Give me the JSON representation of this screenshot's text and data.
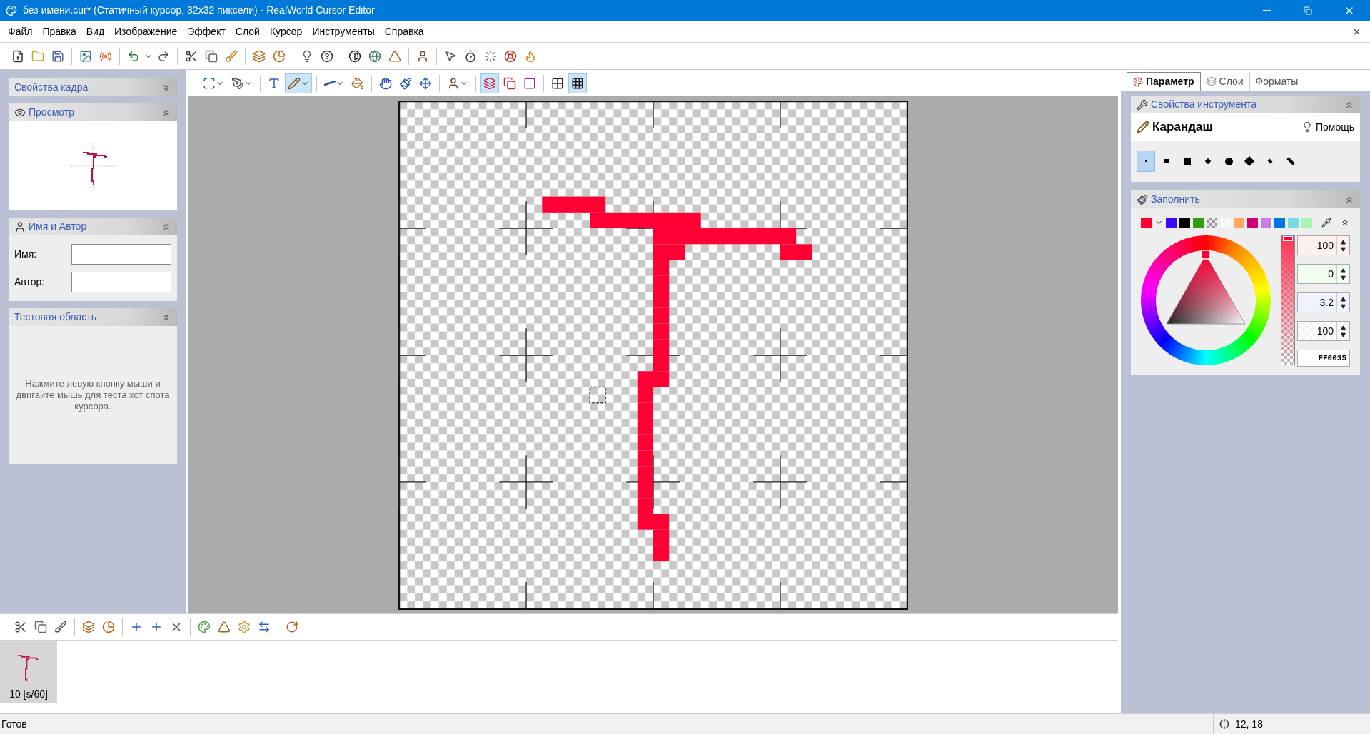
{
  "window": {
    "title": "без имени.cur* (Статичный курсор, 32x32 пиксели) - RealWorld Cursor Editor"
  },
  "menu": [
    "Файл",
    "Правка",
    "Вид",
    "Изображение",
    "Эффект",
    "Слой",
    "Курсор",
    "Инструменты",
    "Справка"
  ],
  "tools": [
    {
      "selected": false
    },
    {
      "selected": false
    },
    {
      "selected": false
    },
    {
      "selected": true
    },
    {
      "selected": false
    },
    {
      "selected": false
    },
    {
      "selected": false
    },
    {
      "selected": false
    },
    {
      "selected": false
    },
    {
      "selected": false
    },
    {
      "selected": true
    },
    {
      "selected": false
    },
    {
      "selected": false
    },
    {
      "selected": false
    },
    {
      "selected": true
    }
  ],
  "left_panels": {
    "frame_props": {
      "title": "Свойства кадра",
      "expanded": false
    },
    "preview": {
      "title": "Просмотр",
      "expanded": true
    },
    "name_author": {
      "title": "Имя и Автор",
      "expanded": true,
      "fields": [
        {
          "label": "Имя:"
        },
        {
          "label": "Автор:"
        }
      ]
    },
    "test_area": {
      "title": "Тестовая область",
      "expanded": true,
      "hint": "Нажмите левую кнопку мыши и двигайте мышь для теста хот спота курсора."
    }
  },
  "right_tabs": [
    {
      "label": "Параметр",
      "selected": true
    },
    {
      "label": "Слои",
      "selected": false
    },
    {
      "label": "Форматы",
      "selected": false
    }
  ],
  "tool_properties": {
    "title": "Свойства инструмента",
    "expanded": true,
    "tool_name": "Карандаш",
    "help": "Помощь",
    "brushes": [
      {
        "selected": true
      },
      {
        "selected": false
      },
      {
        "selected": false
      },
      {
        "selected": false
      },
      {
        "selected": false
      },
      {
        "selected": false
      },
      {
        "selected": false
      },
      {
        "selected": false
      }
    ]
  },
  "fill": {
    "title": "Заполнить",
    "expanded": true,
    "palette": [
      {
        "kind": "solid",
        "color": "#3b0aff"
      },
      {
        "kind": "solid",
        "color": "#000000"
      },
      {
        "kind": "solid",
        "color": "#2f9e0f"
      },
      {
        "kind": "transparent"
      },
      {
        "kind": "solid",
        "color": "#f8f8f8"
      },
      {
        "kind": "solid",
        "color": "#ffa860"
      },
      {
        "kind": "solid",
        "color": "#cc0077"
      },
      {
        "kind": "solid",
        "color": "#c77ee0"
      },
      {
        "kind": "solid",
        "color": "#0077e6"
      },
      {
        "kind": "solid",
        "color": "#7ad8e0"
      },
      {
        "kind": "solid",
        "color": "#a8f5b0"
      }
    ],
    "values": [
      "100",
      "0",
      "3.2",
      "100"
    ],
    "hex": "FF0035",
    "alpha_slider": {
      "level": 1
    }
  },
  "frames": [
    {
      "label": "10 [s/60]",
      "selected": true
    }
  ],
  "status_bar": {
    "text": "Готов",
    "coordinates": "12, 18"
  }
}
